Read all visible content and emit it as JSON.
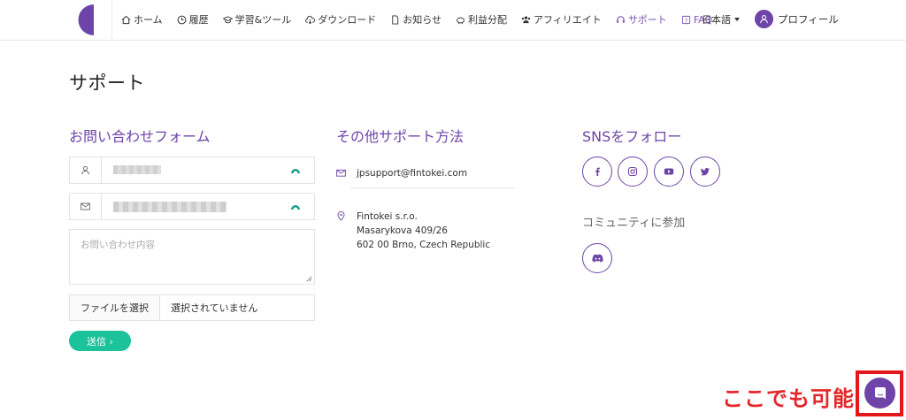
{
  "nav": {
    "items": [
      {
        "label": "ホーム",
        "icon": "home-icon"
      },
      {
        "label": "履歴",
        "icon": "clock-icon"
      },
      {
        "label": "学習&ツール",
        "icon": "graduation-cap-icon"
      },
      {
        "label": "ダウンロード",
        "icon": "cloud-download-icon"
      },
      {
        "label": "お知らせ",
        "icon": "document-icon"
      },
      {
        "label": "利益分配",
        "icon": "piggy-bank-icon"
      },
      {
        "label": "アフィリエイト",
        "icon": "users-icon"
      },
      {
        "label": "サポート",
        "icon": "headset-icon",
        "active": true
      },
      {
        "label": "FAQ",
        "icon": "question-icon"
      }
    ],
    "language": "日本語",
    "profile_label": "プロフィール"
  },
  "page": {
    "title": "サポート"
  },
  "contact_form": {
    "heading": "お問い合わせフォーム",
    "message_placeholder": "お問い合わせ内容",
    "file_button": "ファイルを選択",
    "file_status": "選択されていません",
    "submit_label": "送信 ›"
  },
  "other_support": {
    "heading": "その他サポート方法",
    "email": "jpsupport@fintokei.com",
    "address_lines": [
      "Fintokei s.r.o.",
      "Masarykova 409/26",
      "602 00 Brno, Czech Republic"
    ]
  },
  "sns": {
    "heading": "SNSをフォロー",
    "networks": [
      "facebook-icon",
      "instagram-icon",
      "youtube-icon",
      "twitter-icon"
    ],
    "community_label": "コミュニティに参加",
    "community_networks": [
      "discord-icon"
    ]
  },
  "annotation": {
    "text": "ここでも可能"
  },
  "colors": {
    "brand_purple": "#6e44a8",
    "submit_green": "#1cc29a",
    "annotation_red": "#e4282a"
  }
}
